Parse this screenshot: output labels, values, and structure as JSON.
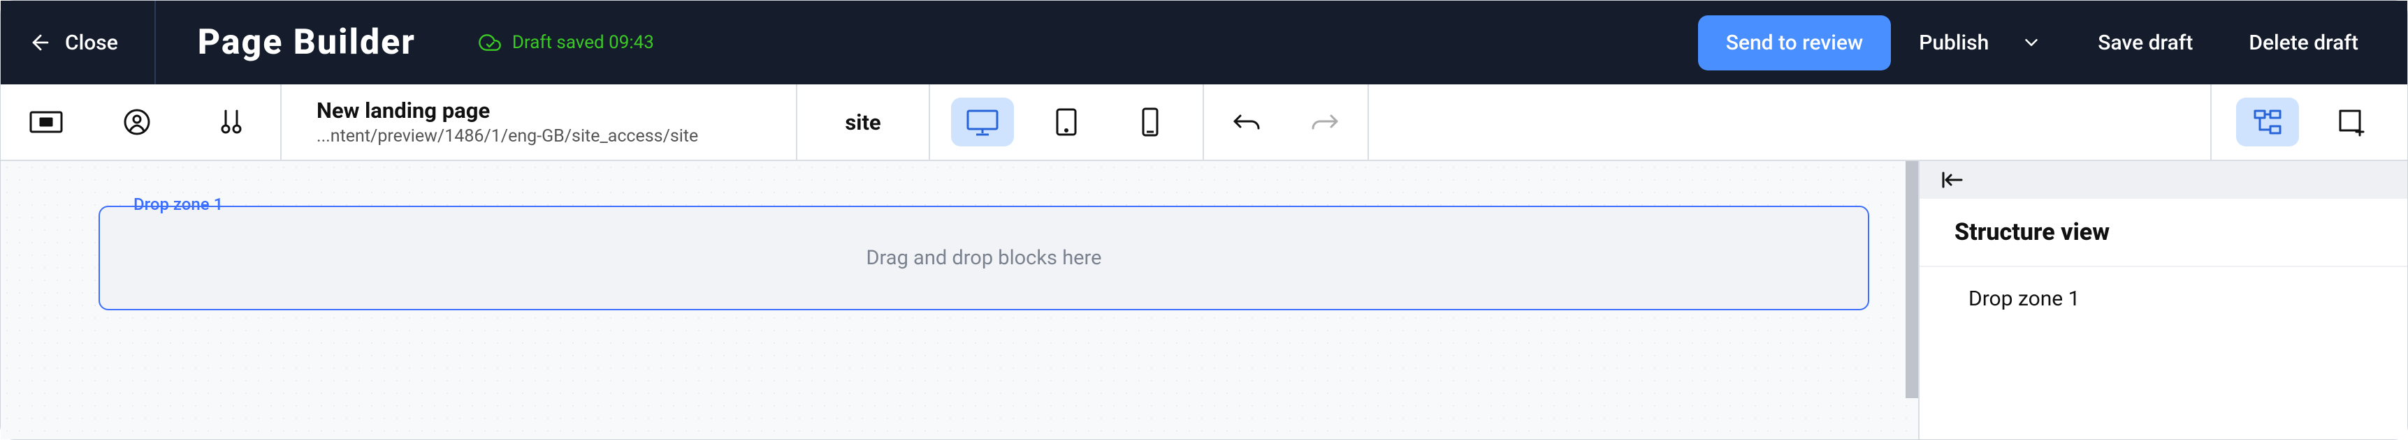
{
  "header": {
    "close_label": "Close",
    "app_title": "Page Builder",
    "save_status": "Draft saved 09:43",
    "send_review_label": "Send to review",
    "publish_label": "Publish",
    "save_draft_label": "Save draft",
    "delete_draft_label": "Delete draft"
  },
  "toolbar": {
    "page_title": "New landing page",
    "page_path": "...ntent/preview/1486/1/eng-GB/site_access/site",
    "site_label": "site"
  },
  "canvas": {
    "drop_zone_label": "Drop zone 1",
    "drop_zone_placeholder": "Drag and drop blocks here"
  },
  "panel": {
    "title": "Structure view",
    "item_1": "Drop zone 1"
  }
}
